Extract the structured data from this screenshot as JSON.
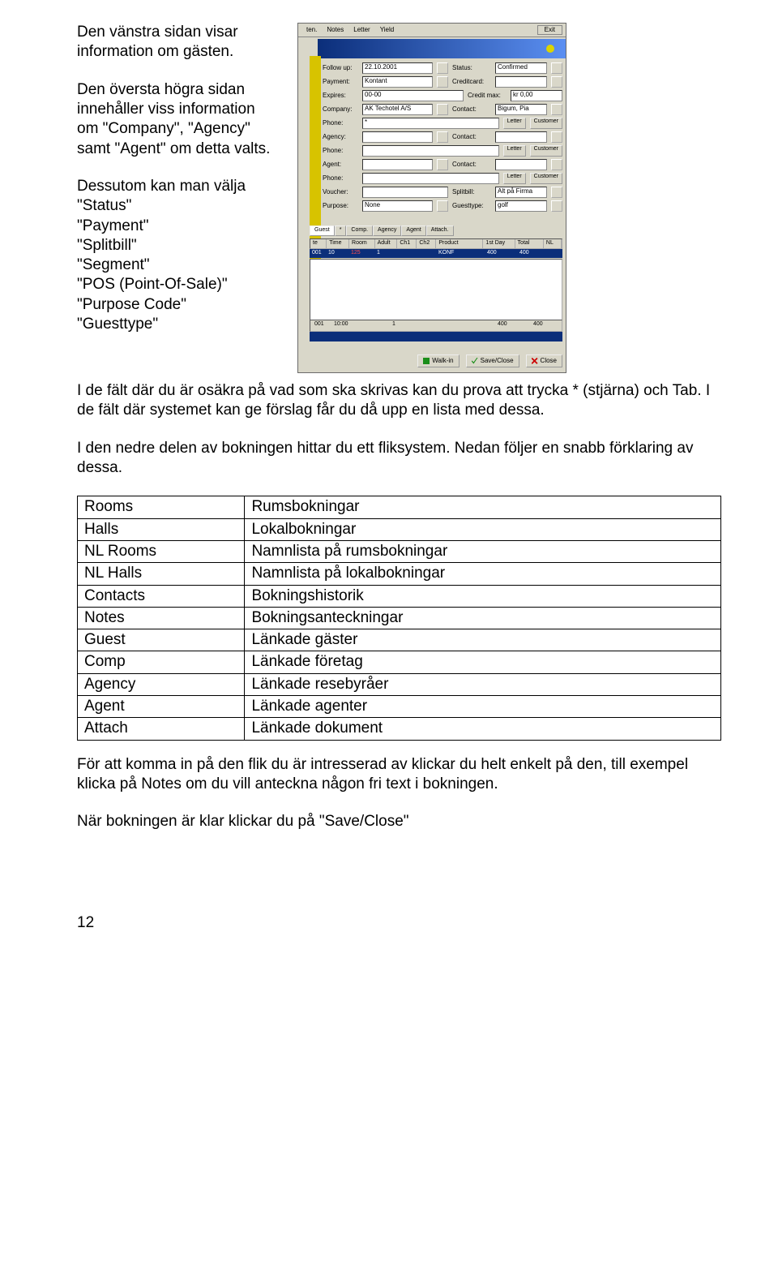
{
  "left": {
    "p1": "Den vänstra sidan visar information om gästen.",
    "p2": "Den översta högra sidan innehåller viss information om \"Company\", \"Agency\" samt \"Agent\" om detta valts.",
    "p3_lead": "Dessutom kan man välja",
    "p3_items": [
      "\"Status\"",
      "\"Payment\"",
      "\"Splitbill\"",
      "\"Segment\"",
      "\"POS (Point-Of-Sale)\"",
      "\"Purpose Code\"",
      "\"Guesttype\""
    ]
  },
  "screenshot": {
    "toolbar": [
      "ten.",
      "Notes",
      "Letter",
      "Yield"
    ],
    "exit": "Exit",
    "fields": {
      "followup_lbl": "Follow up:",
      "followup_val": "22.10.2001",
      "status_lbl": "Status:",
      "status_val": "Confirmed",
      "payment_lbl": "Payment:",
      "payment_val": "Kontant",
      "creditcard_lbl": "Creditcard:",
      "expires_lbl": "Expires:",
      "expires_val": "00-00",
      "creditmax_lbl": "Credit max:",
      "creditmax_val": "kr 0,00",
      "company_lbl": "Company:",
      "company_val": "AK Techotel A/S",
      "contact_lbl": "Contact:",
      "contact_val": "Bigum, Pia",
      "phone_lbl": "Phone:",
      "phone_val": "*",
      "letter_btn": "Letter",
      "customer_btn": "Customer",
      "agency_lbl": "Agency:",
      "contact2_lbl": "Contact:",
      "agent_lbl": "Agent:",
      "voucher_lbl": "Voucher:",
      "splitbill_lbl": "Splitbill:",
      "splitbill_val": "Alt på Firma",
      "purpose_lbl": "Purpose:",
      "purpose_val": "None",
      "guesttype_lbl": "Guesttype:",
      "guesttype_val": "golf"
    },
    "tabs": [
      "Guest",
      "*",
      "Comp.",
      "Agency",
      "Agent",
      "Attach."
    ],
    "grid_headers": [
      "te",
      "Time",
      "Room",
      "Adult",
      "Ch1",
      "Ch2",
      "Product",
      "1st Day",
      "Total",
      "NL"
    ],
    "grid_row": [
      "001",
      "10",
      "125",
      "1",
      "",
      "",
      "KONF",
      "400",
      "400",
      ""
    ],
    "grid_footer": [
      "001",
      "10:00",
      "",
      "1",
      "",
      "",
      "",
      "400",
      "400",
      ""
    ],
    "buttons": {
      "walkin": "Walk-in",
      "save": "Save/Close",
      "close": "Close"
    }
  },
  "mid": {
    "p1": "I de fält där du är osäkra på vad som ska skrivas kan du prova att trycka * (stjärna) och Tab. I de fält där systemet kan ge förslag får du då upp en lista med dessa.",
    "p2": "I den nedre delen av bokningen hittar du ett fliksystem. Nedan följer en snabb förklaring av dessa."
  },
  "table": [
    [
      "Rooms",
      "Rumsbokningar"
    ],
    [
      "Halls",
      "Lokalbokningar"
    ],
    [
      "NL Rooms",
      "Namnlista på rumsbokningar"
    ],
    [
      "NL Halls",
      "Namnlista på lokalbokningar"
    ],
    [
      "Contacts",
      "Bokningshistorik"
    ],
    [
      "Notes",
      "Bokningsanteckningar"
    ],
    [
      "Guest",
      "Länkade gäster"
    ],
    [
      "Comp",
      "Länkade företag"
    ],
    [
      "Agency",
      "Länkade resebyråer"
    ],
    [
      "Agent",
      "Länkade agenter"
    ],
    [
      "Attach",
      "Länkade dokument"
    ]
  ],
  "tail": {
    "p1": "För att komma in på den flik du är intresserad av klickar du helt enkelt på den, till exempel klicka på Notes om du vill anteckna någon fri text i bokningen.",
    "p2": "När bokningen är klar klickar du på \"Save/Close\""
  },
  "page": "12"
}
